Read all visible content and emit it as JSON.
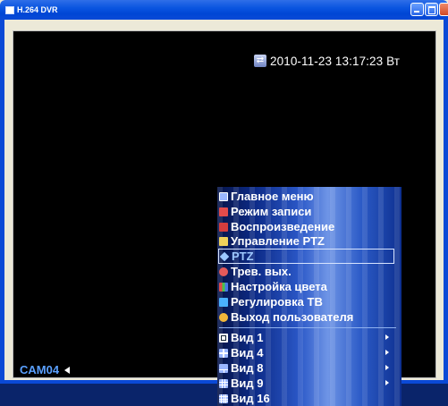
{
  "window": {
    "title": "H.264 DVR"
  },
  "overlay": {
    "datetime": "2010-11-23 13:17:23 Вт",
    "camera_label": "CAM04"
  },
  "menu": {
    "items": [
      {
        "label": "Главное меню",
        "icon": "main-menu-icon",
        "color": "#9ab6ff"
      },
      {
        "label": "Режим записи",
        "icon": "record-mode-icon",
        "color": "#e24b4b"
      },
      {
        "label": "Воспроизведение",
        "icon": "playback-icon",
        "color": "#d53d3d"
      },
      {
        "label": "Управление PTZ",
        "icon": "ptz-control-icon",
        "color": "#f0d25a"
      },
      {
        "label": "PTZ",
        "icon": "ptz-icon",
        "color": "#9dc8ff"
      },
      {
        "label": "Трев. вых.",
        "icon": "alarm-output-icon",
        "color": "#e45a5a"
      },
      {
        "label": "Настройка цвета",
        "icon": "color-settings-icon",
        "color": "#c04bd0"
      },
      {
        "label": "Регулировка ТВ",
        "icon": "tv-adjust-icon",
        "color": "#4ab2ff"
      },
      {
        "label": "Выход пользователя",
        "icon": "logout-icon",
        "color": "#f2b83a"
      }
    ],
    "views": [
      {
        "label": "Вид 1",
        "icon": "view-1-icon",
        "has_submenu": true
      },
      {
        "label": "Вид 4",
        "icon": "view-4-icon",
        "has_submenu": true
      },
      {
        "label": "Вид 8",
        "icon": "view-8-icon",
        "has_submenu": true
      },
      {
        "label": "Вид 9",
        "icon": "view-9-icon",
        "has_submenu": true
      },
      {
        "label": "Вид 16",
        "icon": "view-16-icon",
        "has_submenu": false
      }
    ]
  }
}
